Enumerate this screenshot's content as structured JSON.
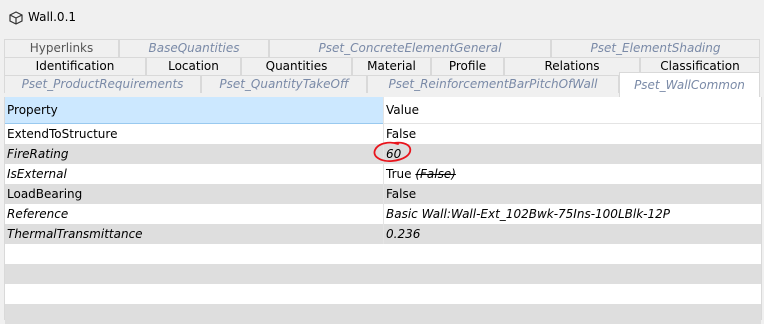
{
  "window": {
    "title": "Wall.0.1"
  },
  "tabs": {
    "row1": [
      {
        "label": "Hyperlinks",
        "style": "normal"
      },
      {
        "label": "BaseQuantities",
        "style": "faded"
      },
      {
        "label": "Pset_ConcreteElementGeneral",
        "style": "faded"
      },
      {
        "label": "Pset_ElementShading",
        "style": "faded"
      }
    ],
    "row2": [
      {
        "label": "Identification"
      },
      {
        "label": "Location"
      },
      {
        "label": "Quantities"
      },
      {
        "label": "Material"
      },
      {
        "label": "Profile"
      },
      {
        "label": "Relations"
      },
      {
        "label": "Classification"
      }
    ],
    "row3": [
      {
        "label": "Pset_ProductRequirements"
      },
      {
        "label": "Pset_QuantityTakeOff"
      },
      {
        "label": "Pset_ReinforcementBarPitchOfWall"
      },
      {
        "label": "Pset_WallCommon",
        "selected": true
      }
    ]
  },
  "table": {
    "headers": {
      "property": "Property",
      "value": "Value"
    },
    "rows": [
      {
        "property": "ExtendToStructure",
        "value": "False",
        "italic": false
      },
      {
        "property": "FireRating",
        "value": "60",
        "italic": true,
        "annotated": true
      },
      {
        "property": "IsExternal",
        "value": "True",
        "struck_value": "(False)",
        "italic": true
      },
      {
        "property": "LoadBearing",
        "value": "False",
        "italic": false
      },
      {
        "property": "Reference",
        "value": "Basic Wall:Wall-Ext_102Bwk-75Ins-100LBlk-12P",
        "italic": true
      },
      {
        "property": "ThermalTransmittance",
        "value": "0.236",
        "italic": true
      }
    ]
  },
  "colors": {
    "header_selected": "#cce8ff",
    "row_shaded": "#dedede",
    "annotation_red": "#e8141c",
    "faded_tab_text": "#7a8aa7"
  },
  "icons": {
    "title_icon": "cube-icon"
  }
}
